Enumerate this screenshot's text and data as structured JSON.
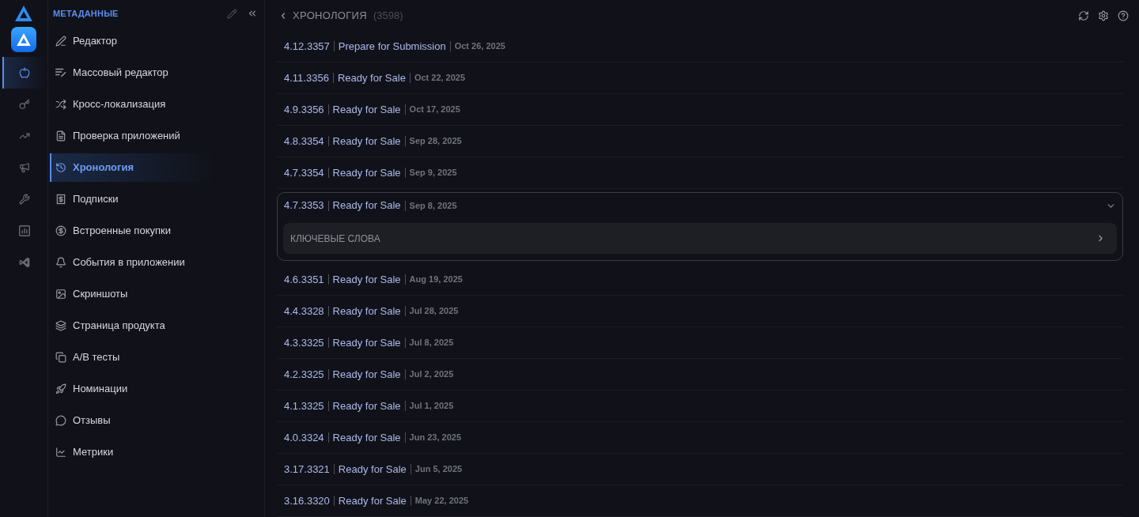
{
  "rail": {
    "items": [
      {
        "selected": true
      },
      {
        "selected": false
      },
      {
        "selected": false
      },
      {
        "selected": false
      },
      {
        "selected": false
      },
      {
        "selected": false
      },
      {
        "selected": false
      }
    ]
  },
  "sidebar": {
    "title": "МЕТАДАННЫЕ",
    "items": [
      {
        "label": "Редактор",
        "selected": false
      },
      {
        "label": "Массовый редактор",
        "selected": false
      },
      {
        "label": "Кросс-локализация",
        "selected": false
      },
      {
        "label": "Проверка приложений",
        "selected": false
      },
      {
        "label": "Хронология",
        "selected": true
      },
      {
        "label": "Подписки",
        "selected": false
      },
      {
        "label": "Встроенные покупки",
        "selected": false
      },
      {
        "label": "События в приложении",
        "selected": false
      },
      {
        "label": "Скриншоты",
        "selected": false
      },
      {
        "label": "Страница продукта",
        "selected": false
      },
      {
        "label": "A/B тесты",
        "selected": false
      },
      {
        "label": "Номинации",
        "selected": false
      },
      {
        "label": "Отзывы",
        "selected": false
      },
      {
        "label": "Метрики",
        "selected": false
      }
    ]
  },
  "main": {
    "title": "ХРОНОЛОГИЯ",
    "count": "(3598)",
    "versions": [
      {
        "version": "4.12.3357",
        "status": "Prepare for Submission",
        "date": "Oct 26, 2025",
        "expanded": false
      },
      {
        "version": "4.11.3356",
        "status": "Ready for Sale",
        "date": "Oct 22, 2025",
        "expanded": false
      },
      {
        "version": "4.9.3356",
        "status": "Ready for Sale",
        "date": "Oct 17, 2025",
        "expanded": false
      },
      {
        "version": "4.8.3354",
        "status": "Ready for Sale",
        "date": "Sep 28, 2025",
        "expanded": false
      },
      {
        "version": "4.7.3354",
        "status": "Ready for Sale",
        "date": "Sep 9, 2025",
        "expanded": false
      },
      {
        "version": "4.7.3353",
        "status": "Ready for Sale",
        "date": "Sep 8, 2025",
        "expanded": true,
        "sections": [
          "КЛЮЧЕВЫЕ СЛОВА"
        ]
      },
      {
        "version": "4.6.3351",
        "status": "Ready for Sale",
        "date": "Aug 19, 2025",
        "expanded": false
      },
      {
        "version": "4.4.3328",
        "status": "Ready for Sale",
        "date": "Jul 28, 2025",
        "expanded": false
      },
      {
        "version": "4.3.3325",
        "status": "Ready for Sale",
        "date": "Jul 8, 2025",
        "expanded": false
      },
      {
        "version": "4.2.3325",
        "status": "Ready for Sale",
        "date": "Jul 2, 2025",
        "expanded": false
      },
      {
        "version": "4.1.3325",
        "status": "Ready for Sale",
        "date": "Jul 1, 2025",
        "expanded": false
      },
      {
        "version": "4.0.3324",
        "status": "Ready for Sale",
        "date": "Jun 23, 2025",
        "expanded": false
      },
      {
        "version": "3.17.3321",
        "status": "Ready for Sale",
        "date": "Jun 5, 2025",
        "expanded": false
      },
      {
        "version": "3.16.3320",
        "status": "Ready for Sale",
        "date": "May 22, 2025",
        "expanded": false
      }
    ]
  }
}
